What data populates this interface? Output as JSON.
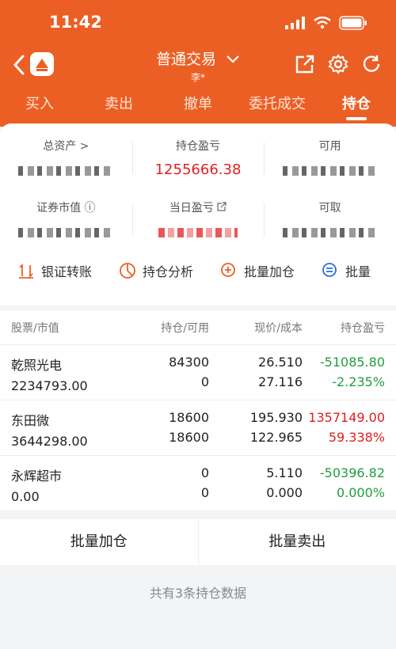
{
  "status": {
    "time": "11:42"
  },
  "header": {
    "title": "普通交易",
    "account": "李*"
  },
  "tabs": [
    "买入",
    "卖出",
    "撤单",
    "委托成交",
    "持仓"
  ],
  "summary": {
    "total_assets_label": "总资产 >",
    "position_pl_label": "持仓盈亏",
    "position_pl_value": "1255666.38",
    "available_label": "可用",
    "market_value_label": "证券市值 ⓘ",
    "daily_pl_label": "当日盈亏",
    "withdrawable_label": "可取"
  },
  "quick_actions": [
    {
      "label": "银证转账",
      "icon": "transfer-icon"
    },
    {
      "label": "持仓分析",
      "icon": "analysis-icon"
    },
    {
      "label": "批量加仓",
      "icon": "add-position-icon"
    },
    {
      "label": "批量",
      "icon": "batch-icon"
    }
  ],
  "table": {
    "headers": [
      "股票/市值",
      "持仓/可用",
      "现价/成本",
      "持仓盈亏"
    ],
    "rows": [
      {
        "name": "乾照光电",
        "market_value": "2234793.00",
        "position": "84300",
        "available": "0",
        "price": "26.510",
        "cost": "27.116",
        "pl": "-51085.80",
        "pl_pct": "-2.235%",
        "trend": "down"
      },
      {
        "name": "东田微",
        "market_value": "3644298.00",
        "position": "18600",
        "available": "18600",
        "price": "195.930",
        "cost": "122.965",
        "pl": "1357149.00",
        "pl_pct": "59.338%",
        "trend": "up"
      },
      {
        "name": "永辉超市",
        "market_value": "0.00",
        "position": "0",
        "available": "0",
        "price": "5.110",
        "cost": "0.000",
        "pl": "-50396.82",
        "pl_pct": "0.000%",
        "trend": "down"
      }
    ]
  },
  "buttons": {
    "batch_add": "批量加仓",
    "batch_sell": "批量卖出"
  },
  "footer": {
    "note": "共有3条持仓数据"
  },
  "colors": {
    "brand": "#ec5f24",
    "up": "#e02020",
    "down": "#1f9e3c"
  }
}
